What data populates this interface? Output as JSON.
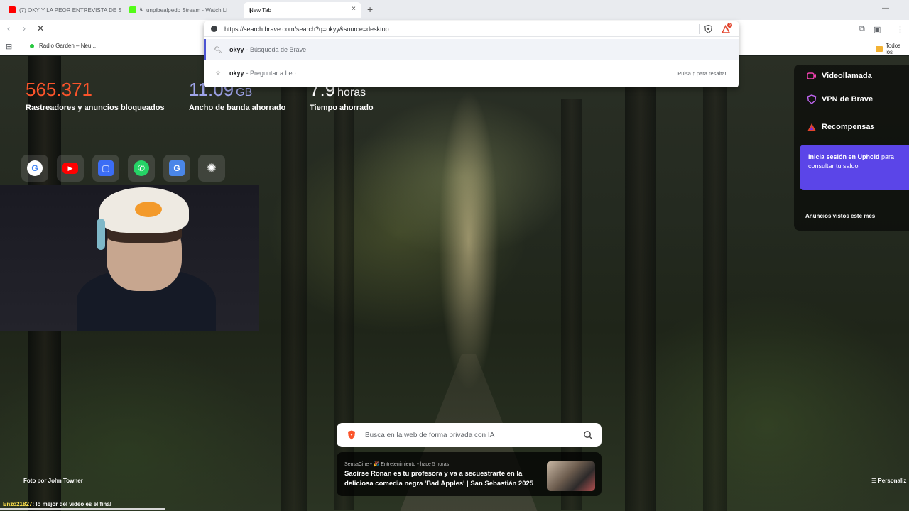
{
  "tabs": [
    {
      "title": "(7) OKY Y LA PEOR ENTREVISTA DE S",
      "favicon_color": "#ff0000",
      "muted": false
    },
    {
      "title": "unpibealpedo Stream - Watch Li",
      "favicon_color": "#53fc18",
      "muted": true
    },
    {
      "title": "New Tab",
      "favicon_color": "",
      "muted": false,
      "active": true
    }
  ],
  "tab_close": "×",
  "new_tab": "+",
  "address": {
    "url": "https://search.brave.com/search?q=okyy&source=desktop",
    "notification_count": "6"
  },
  "omnibox": {
    "suggestions": [
      {
        "query": "okyy",
        "rest": "- Búsqueda de Brave",
        "icon": "search-icon"
      },
      {
        "query": "okyy",
        "rest": "- Preguntar a Leo",
        "icon": "leo-icon",
        "hint": "Pulsa ↑ para resaltar"
      }
    ]
  },
  "bookmarks": {
    "item": "Radio Garden – Neu...",
    "folder": "Todos los"
  },
  "stats": [
    {
      "number": "565.371",
      "unit": "",
      "label": "Rastreadores y anuncios bloqueados",
      "color": "#fb542b"
    },
    {
      "number": "11.09",
      "unit": "GB",
      "label": "Ancho de banda ahorrado",
      "color": "#a0a5eb"
    },
    {
      "number": "7.9",
      "unit": "horas",
      "label": "Tiempo ahorrado",
      "color": "#ffffff"
    }
  ],
  "top_sites": [
    {
      "name": "google",
      "glyph": "G",
      "bg": "#ffffff",
      "fg": "#4285f4"
    },
    {
      "name": "youtube",
      "glyph": "▶",
      "bg": "#ff0000",
      "fg": "#ffffff"
    },
    {
      "name": "app",
      "glyph": "▢",
      "bg": "#3b6df5",
      "fg": "#ffffff"
    },
    {
      "name": "whatsapp",
      "glyph": "✆",
      "bg": "#25d366",
      "fg": "#ffffff"
    },
    {
      "name": "translate",
      "glyph": "G",
      "bg": "#4a86e8",
      "fg": "#ffffff"
    },
    {
      "name": "openai",
      "glyph": "✺",
      "bg": "transparent",
      "fg": "#ffffff"
    }
  ],
  "widget": {
    "videocall": "Videollamada",
    "vpn": "VPN de Brave",
    "rewards": "Recompensas",
    "uphold_bold": "Inicia sesión en Uphold",
    "uphold_rest": "para consultar tu saldo",
    "ads_seen": "Anuncios vistos este mes"
  },
  "search": {
    "placeholder": "Busca en la web de forma privada con IA"
  },
  "news": {
    "source": "SensaCine • 🎉 Entretenimiento • hace 5 horas",
    "title": "Saoirse Ronan es tu profesora y va a secuestrarte en la deliciosa comedia negra 'Bad Apples' | San Sebastián 2025"
  },
  "photo_credit": "Foto por John Towner",
  "customize": "Personaliz",
  "chat": {
    "user": "Enzo21827",
    "message": ": lo mejor del video es el final"
  }
}
